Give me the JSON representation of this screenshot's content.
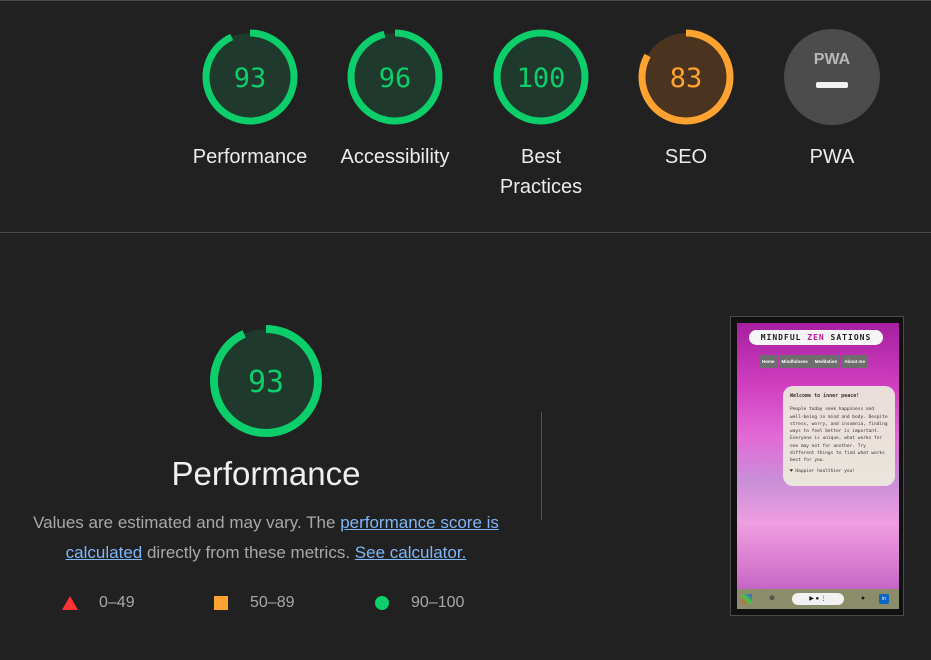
{
  "categories": [
    {
      "id": "performance",
      "score": "93",
      "value": 93,
      "label": "Performance",
      "color": "#0cce6b",
      "bg": "#1f3a2c"
    },
    {
      "id": "accessibility",
      "score": "96",
      "value": 96,
      "label": "Accessibility",
      "color": "#0cce6b",
      "bg": "#1f3a2c"
    },
    {
      "id": "best-practices",
      "score": "100",
      "value": 100,
      "label_line1": "Best",
      "label_line2": "Practices",
      "color": "#0cce6b",
      "bg": "#1f3a2c"
    },
    {
      "id": "seo",
      "score": "83",
      "value": 83,
      "label": "SEO",
      "color": "#ffa330",
      "bg": "#4a3420"
    },
    {
      "id": "pwa",
      "label": "PWA",
      "badge_text": "PWA",
      "color": "#4c4c4c"
    }
  ],
  "main": {
    "score": "93",
    "value": 93,
    "title": "Performance",
    "desc_part1": "Values are estimated and may vary. The ",
    "link_score": "performance score is calculated",
    "desc_part2": " directly from these metrics. ",
    "link_calc": "See calculator."
  },
  "legend": [
    {
      "range": "0–49",
      "color": "#ff3333"
    },
    {
      "range": "50–89",
      "color": "#ffa330"
    },
    {
      "range": "90–100",
      "color": "#0cce6b"
    }
  ],
  "screenshot": {
    "logo_part1": "MINDFUL ",
    "logo_zen": "ZEN",
    "logo_part2": "SATIONS",
    "nav": [
      "Home",
      "Mindfulness",
      "Meditation",
      "About me"
    ],
    "card_heading": "Welcome to inner peace!",
    "card_text": "People today seek happiness and well-being in mind and body. Despite stress, worry, and insomnia, finding ways to feel better is important. Everyone is unique, what works for one may not for another. Try different things to find what works best for you.",
    "card_footer": "♥ Happier healthier you!",
    "pill": "▶ ●  ⋮"
  }
}
